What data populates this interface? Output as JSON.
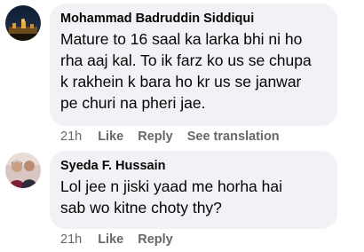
{
  "comments": [
    {
      "author": "Mohammad Badruddin Siddiqui",
      "text": "Mature to 16 saal ka larka bhi ni ho\nrha aaj kal. To ik farz ko us se chupa\nk rakhein k bara ho kr us se janwar\npe churi na pheri jae.",
      "time": "21h",
      "like": "Like",
      "reply": "Reply",
      "translate": "See translation"
    },
    {
      "author": "Syeda F. Hussain",
      "text": "Lol jee n jiski yaad me horha hai\nsab wo kitne choty thy?",
      "time": "21h",
      "like": "Like",
      "reply": "Reply"
    }
  ]
}
